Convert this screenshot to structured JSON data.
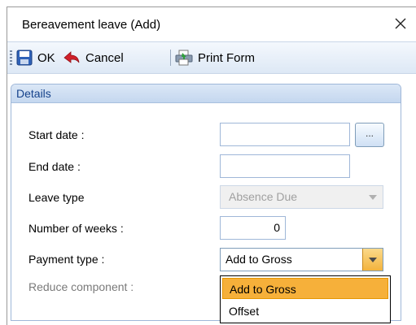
{
  "window": {
    "title": "Bereavement leave (Add)"
  },
  "toolbar": {
    "ok_label": "OK",
    "cancel_label": "Cancel",
    "print_label": "Print Form"
  },
  "panel": {
    "title": "Details"
  },
  "form": {
    "start_date": {
      "label": "Start date :",
      "value": ""
    },
    "end_date": {
      "label": "End date :",
      "value": ""
    },
    "leave_type": {
      "label": "Leave type",
      "value": "Absence Due",
      "disabled": true
    },
    "number_of_weeks": {
      "label": "Number of weeks :",
      "value": "0"
    },
    "payment_type": {
      "label": "Payment type :",
      "value": "Add to Gross",
      "options": [
        "Add to Gross",
        "Offset"
      ],
      "open": true
    },
    "reduce_component": {
      "label": "Reduce component :",
      "disabled": true
    },
    "ellipsis_label": "..."
  },
  "colors": {
    "accent": "#15428b",
    "highlight": "#f6b03a",
    "border": "#9fb7d8"
  },
  "icons": {
    "close": "close-icon",
    "ok": "save-icon",
    "cancel": "back-arrow-icon",
    "print": "print-icon",
    "dropdown": "chevron-down-icon"
  }
}
